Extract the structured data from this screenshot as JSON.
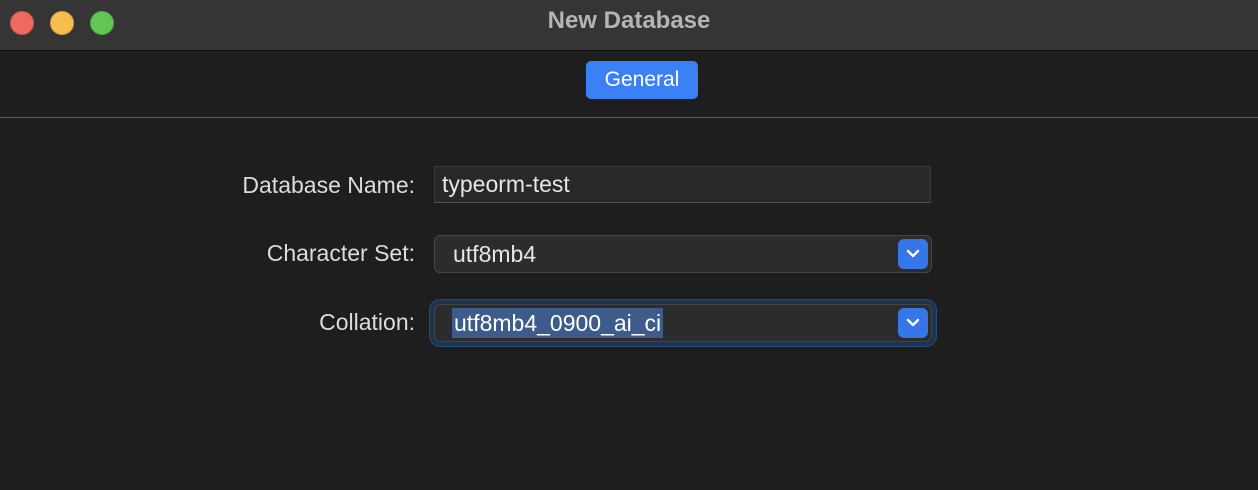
{
  "window": {
    "title": "New Database"
  },
  "tabs": [
    {
      "label": "General",
      "selected": true
    }
  ],
  "form": {
    "database_name": {
      "label": "Database Name:",
      "value": "typeorm-test"
    },
    "character_set": {
      "label": "Character Set:",
      "value": "utf8mb4"
    },
    "collation": {
      "label": "Collation:",
      "value": "utf8mb4_0900_ai_ci"
    }
  },
  "colors": {
    "accent": "#3a81f7",
    "window_bg": "#1e1e1e",
    "titlebar_bg": "#353535",
    "selection_bg": "#3d5c8c",
    "close": "#ee6a5f",
    "minimize": "#f5be4f",
    "maximize": "#62c655"
  }
}
